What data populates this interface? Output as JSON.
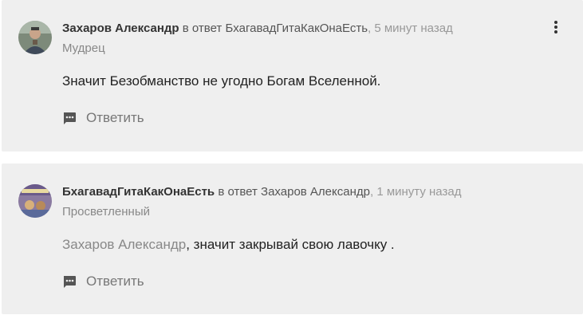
{
  "comments": [
    {
      "author": "Захаров Александр",
      "reply_prefix": " в ответ ",
      "reply_to": "БхагавадГитаКакОнаЕсть",
      "time": ", 5 минут назад",
      "rank": "Мудрец",
      "mention": "",
      "text": "Значит Безобманство не угодно Богам Вселенной.",
      "reply_label": "Ответить",
      "avatar_icon": "user-avatar-photo"
    },
    {
      "author": "БхагавадГитаКакОнаЕсть",
      "reply_prefix": " в ответ ",
      "reply_to": "Захаров Александр",
      "time": ", 1 минуту назад",
      "rank": "Просветленный",
      "mention": "Захаров Александр",
      "text": ", значит закрывай свою лавочку .",
      "reply_label": "Ответить",
      "avatar_icon": "book-cover-avatar"
    }
  ],
  "icons": {
    "reply": "comment-icon",
    "menu": "more-vertical-icon"
  },
  "colors": {
    "card_bg": "#efefef",
    "author": "#333333",
    "muted": "#999999",
    "icon": "#555555"
  }
}
